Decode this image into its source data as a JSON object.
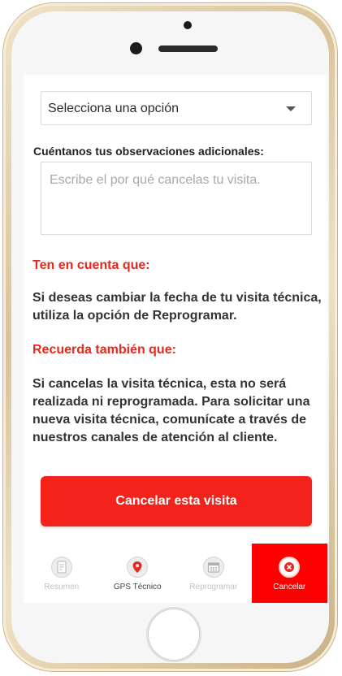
{
  "form": {
    "select_value": "Selecciona una opción",
    "observations_label": "Cuéntanos tus observaciones adicionales:",
    "observations_placeholder": "Escribe el por qué cancelas tu visita."
  },
  "notice": {
    "heading1": "Ten en cuenta que:",
    "text1": "Si deseas cambiar la fecha de tu visita técnica, utiliza la opción de Reprogramar.",
    "heading2": "Recuerda también que:",
    "text2": "Si cancelas la visita técnica, esta no será realizada ni reprogramada. Para solicitar una nueva visita técnica, comunícate a través de nuestros canales de atención al cliente."
  },
  "cta": {
    "label": "Cancelar esta visita"
  },
  "tabs": [
    {
      "label": "Resumen",
      "icon": "document-icon",
      "state": "disabled"
    },
    {
      "label": "GPS Técnico",
      "icon": "location-pin-icon",
      "state": "enabled"
    },
    {
      "label": "Reprogramar",
      "icon": "calendar-icon",
      "state": "disabled"
    },
    {
      "label": "Cancelar",
      "icon": "close-icon",
      "state": "active"
    }
  ],
  "colors": {
    "accent": "#f3231b",
    "heading_red": "#e8271d",
    "active_tab": "#ff0000"
  }
}
